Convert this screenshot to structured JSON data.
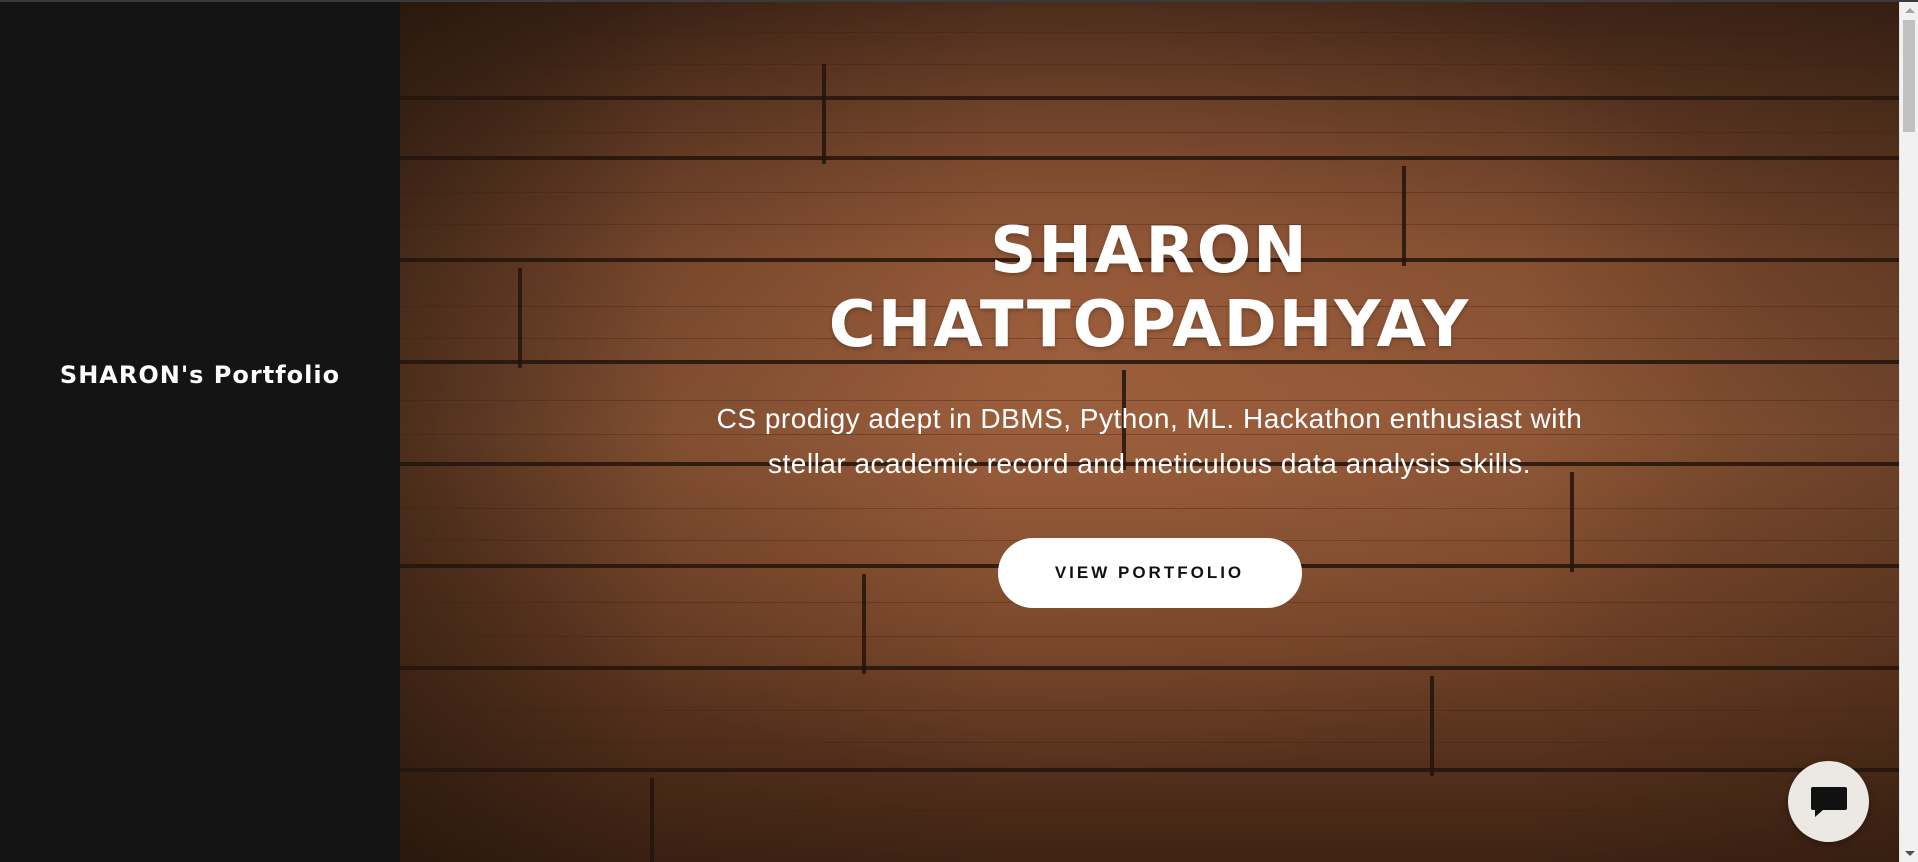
{
  "sidebar": {
    "site_title": "SHARON's Portfolio"
  },
  "hero": {
    "name": "SHARON CHATTOPADHYAY",
    "tagline": "CS prodigy adept in DBMS, Python, ML. Hackathon enthusiast with stellar academic record and meticulous data analysis skills.",
    "cta_label": "VIEW PORTFOLIO",
    "background_icon": "wood-plank-texture"
  },
  "chat": {
    "icon": "chat-bubble-icon"
  },
  "colors": {
    "sidebar_bg": "#141414",
    "hero_wood": "#8b5535",
    "cta_bg": "#ffffff",
    "chat_bg": "#ece8e4"
  }
}
